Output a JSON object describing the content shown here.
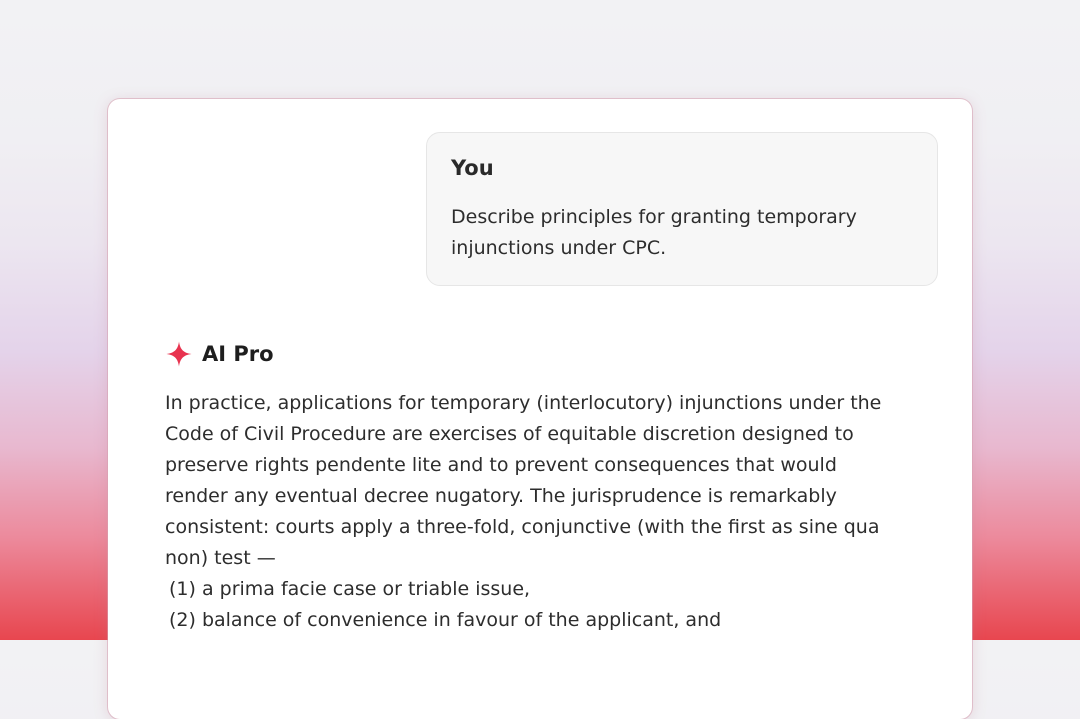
{
  "conversation": {
    "user": {
      "name": "You",
      "message_lines": [
        "Describe principles for granting temporary",
        "injunctions under CPC."
      ]
    },
    "assistant": {
      "name": "AI Pro",
      "icon": "sparkle-icon",
      "accent_color": "#e8334f",
      "paragraph_lines": [
        "In practice, applications for temporary (interlocutory) injunctions under the",
        "Code of Civil Procedure are exercises of equitable discretion designed to",
        "preserve rights pendente lite and to prevent consequences that would",
        "render any eventual decree nugatory. The jurisprudence is remarkably",
        "consistent: courts apply a three-fold, conjunctive (with the first as sine qua",
        "non) test —"
      ],
      "list_items": [
        "(1) a prima facie case or triable issue,",
        "(2) balance of convenience in favour of the applicant, and"
      ]
    }
  }
}
